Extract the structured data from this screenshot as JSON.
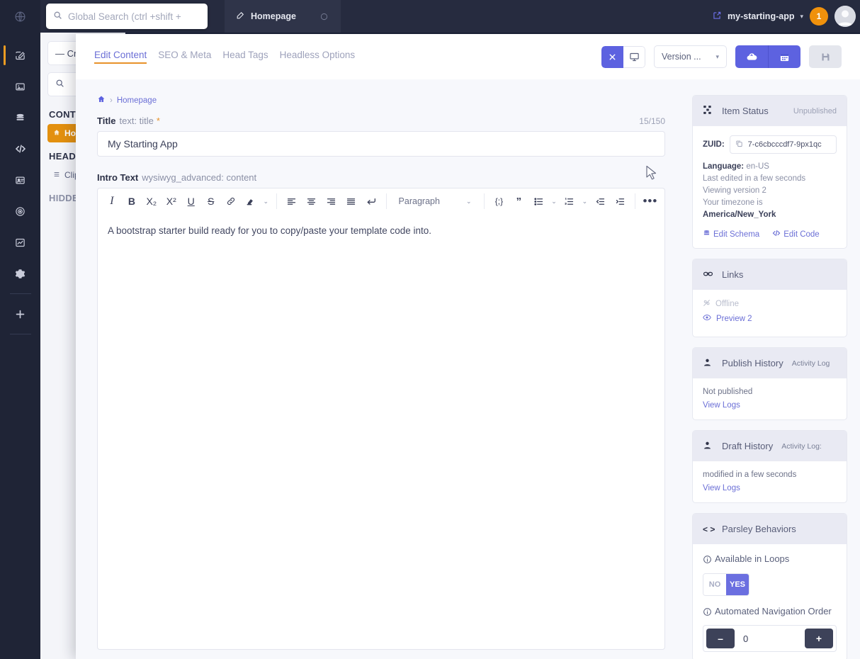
{
  "topbar": {
    "globe_icon": "globe-icon",
    "search": {
      "placeholder": "Global Search (ctrl +shift +",
      "value": "",
      "icon": "search-icon"
    },
    "tabs": [
      {
        "label": "Homepage",
        "icon": "edit-icon",
        "close_icon": "close-icon",
        "active": true
      }
    ],
    "app_name": "my-starting-app",
    "app_icon": "external-link-icon",
    "caret": "▾",
    "notification_count": "1",
    "avatar": "user-avatar"
  },
  "rail": {
    "items": [
      {
        "name": "content",
        "icon": "edit-square-icon",
        "active": true
      },
      {
        "name": "media",
        "icon": "image-icon",
        "active": false
      },
      {
        "name": "schema",
        "icon": "database-icon",
        "active": false
      },
      {
        "name": "code",
        "icon": "code-icon",
        "active": false
      },
      {
        "name": "leads",
        "icon": "contact-card-icon",
        "active": false
      },
      {
        "name": "seo",
        "icon": "target-icon",
        "active": false
      },
      {
        "name": "analytics",
        "icon": "chart-icon",
        "active": false
      },
      {
        "name": "settings",
        "icon": "gear-icon",
        "active": false
      },
      {
        "name": "add",
        "icon": "plus-icon",
        "active": false
      }
    ]
  },
  "contentnav": {
    "create_label": "— Cr",
    "search_placeholder": "",
    "groups": [
      {
        "label": "CONTE",
        "items": [
          {
            "label": "Hom",
            "active": true,
            "icon": "home-icon"
          }
        ]
      },
      {
        "label": "HEADL",
        "items": [
          {
            "label": "Clip",
            "active": false,
            "icon": "layers-icon"
          }
        ]
      },
      {
        "label": "HIDDE",
        "items": []
      }
    ]
  },
  "editor": {
    "tabs": [
      {
        "label": "Edit Content",
        "active": true
      },
      {
        "label": "SEO & Meta",
        "active": false
      },
      {
        "label": "Head Tags",
        "active": false
      },
      {
        "label": "Headless Options",
        "active": false
      }
    ],
    "actions": {
      "close_icon": "close-icon",
      "preview_icon": "monitor-icon",
      "version_label": "Version ...",
      "version_caret": "▾",
      "publish_icon": "cloud-upload-icon",
      "schedule_icon": "calendar-icon",
      "save_icon": "save-icon"
    },
    "breadcrumb": {
      "home_icon": "home-icon",
      "separator": "›",
      "item": "Homepage"
    },
    "title_field": {
      "label": "Title",
      "type_hint": "text: title",
      "required_mark": "*",
      "counter": "15/150",
      "value": "My Starting App",
      "placeholder": ""
    },
    "intro_field": {
      "label": "Intro Text",
      "type_hint": "wysiwyg_advanced: content",
      "content": "A bootstrap starter build ready for you to copy/paste your template code into.",
      "toolbar": {
        "italic": "I",
        "bold": "B",
        "subscript": "X₂",
        "superscript": "X²",
        "underline": "U",
        "strikethrough": "S",
        "link_icon": "link-icon",
        "highlight_icon": "highlighter-icon",
        "highlight_caret": "⌄",
        "align_left_icon": "align-left-icon",
        "align_center_icon": "align-center-icon",
        "align_right_icon": "align-right-icon",
        "align_justify_icon": "align-justify-icon",
        "line_break_icon": "line-break-icon",
        "block_format": "Paragraph",
        "block_caret": "⌄",
        "source_icon": "code-braces-icon",
        "quote_icon": "quote-icon",
        "bullet_list_icon": "bullet-list-icon",
        "bullet_caret": "⌄",
        "number_list_icon": "numbered-list-icon",
        "number_caret": "⌄",
        "outdent_icon": "outdent-icon",
        "indent_icon": "indent-icon",
        "more_icon": "more-horizontal-icon"
      }
    }
  },
  "sidebar": {
    "item_status": {
      "icon": "sitemap-icon",
      "title": "Item Status",
      "status": "Unpublished",
      "zuid_label": "ZUID:",
      "zuid_copy_icon": "copy-icon",
      "zuid_value": "7-c6cbcccdf7-9px1qc",
      "language_key": "Language:",
      "language_value": "en-US",
      "last_edited": "Last edited in a few seconds",
      "viewing_version": "Viewing version 2",
      "timezone_prefix": "Your timezone is",
      "timezone_value": "America/New_York",
      "edit_schema": "Edit Schema",
      "edit_schema_icon": "database-icon",
      "edit_code": "Edit Code",
      "edit_code_icon": "code-icon"
    },
    "links": {
      "icon": "link-chain-icon",
      "title": "Links",
      "offline_label": "Offline",
      "offline_icon": "offline-icon",
      "preview_label": "Preview 2",
      "preview_icon": "eye-icon"
    },
    "publish_history": {
      "icon": "person-icon",
      "title": "Publish History",
      "subtitle": "Activity Log",
      "status": "Not published",
      "view_logs": "View Logs"
    },
    "draft_history": {
      "icon": "person-icon",
      "title": "Draft History",
      "subtitle": "Activity Log:",
      "status": "modified in a few seconds",
      "view_logs": "View Logs"
    },
    "parsley": {
      "icon": "angle-brackets-icon",
      "title": "Parsley Behaviors",
      "available_in_loops": {
        "info_icon": "info-icon",
        "label": "Available in Loops",
        "option_no": "NO",
        "option_yes": "YES",
        "selected": "YES"
      },
      "nav_order": {
        "info_icon": "info-icon",
        "label": "Automated Navigation Order",
        "minus": "–",
        "value": "0",
        "plus": "+"
      }
    }
  },
  "colors": {
    "accent_purple": "#5d62e0",
    "accent_orange": "#e8922a",
    "topbar_bg": "#262b3f",
    "rail_bg": "#1f2436",
    "badge_orange": "#f0910c"
  }
}
